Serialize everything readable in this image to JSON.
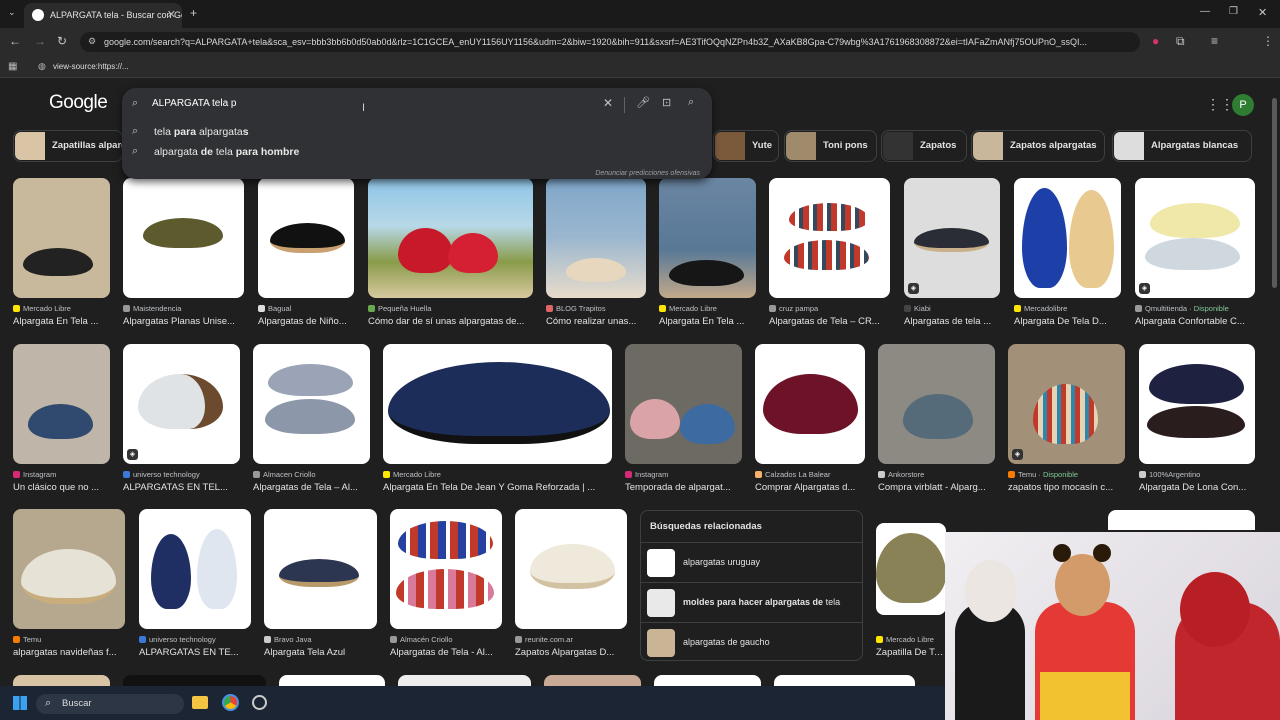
{
  "browser": {
    "tab_title": "ALPARGATA tela - Buscar con Google",
    "url": "google.com/search?q=ALPARGATA+tela&sca_esv=bbb3bb6b0d50ab0d&rlz=1C1GCEA_enUY1156UY1156&udm=2&biw=1920&bih=911&sxsrf=AE3TifOQqNZPn4b3Z_AXaKB8Gpa-C79wbg%3A1761968308872&ei=tIAFaZmANfj75OUPnO_ssQI...",
    "bookmark": "view-source:https://...",
    "profile_initial": "P"
  },
  "google": {
    "logo": "Google",
    "query": "ALPARGATA tela p",
    "suggestions": [
      {
        "pre": "tela ",
        "bold": "para ",
        "mid": "alpargata",
        "bold2": "s"
      },
      {
        "pre": "alpargata ",
        "bold": "de ",
        "mid": "tela ",
        "bold2": "para hombre"
      }
    ],
    "report": "Denunciar predicciones ofensivas",
    "avatar": "P"
  },
  "chips": [
    {
      "label": "Zapatillas alpargatas"
    },
    {
      "label": "Yute"
    },
    {
      "label": "Toni pons"
    },
    {
      "label": "Zapatos"
    },
    {
      "label": "Zapatos alpargatas"
    },
    {
      "label": "Alpargatas blancas"
    }
  ],
  "row1": [
    {
      "src": "Mercado Libre",
      "title": "Alpargata En Tela ...",
      "color": "#ffe600"
    },
    {
      "src": "Maistendencia",
      "title": "Alpargatas Planas Unise...",
      "color": "#999"
    },
    {
      "src": "Bagual",
      "title": "Alpargatas de Niño...",
      "color": "#ddd"
    },
    {
      "src": "Pequeña Huella",
      "title": "Cómo dar de sí unas alpargatas de...",
      "color": "#6aa84f"
    },
    {
      "src": "BLOG Trapitos",
      "title": "Cómo realizar unas...",
      "color": "#e06666"
    },
    {
      "src": "Mercado Libre",
      "title": "Alpargata En Tela ...",
      "color": "#ffe600"
    },
    {
      "src": "cruz pampa",
      "title": "Alpargatas de Tela – CR...",
      "color": "#999"
    },
    {
      "src": "Kiabi",
      "title": "Alpargatas de tela ...",
      "color": "#444"
    },
    {
      "src": "Mercadolibre",
      "title": "Alpargata De Tela D...",
      "color": "#ffe600"
    },
    {
      "src": "Qmultitienda",
      "disp": "Disponible",
      "title": "Alpargata Confortable C...",
      "color": "#999"
    }
  ],
  "row2": [
    {
      "src": "Instagram",
      "title": "Un clásico que no ...",
      "color": "#d62976"
    },
    {
      "src": "universo technology",
      "title": "ALPARGATAS EN TEL...",
      "color": "#3c78d8"
    },
    {
      "src": "Almacen Criollo",
      "title": "Alpargatas de Tela – Al...",
      "color": "#999"
    },
    {
      "src": "Mercado Libre",
      "title": "Alpargata En Tela De Jean Y Goma Reforzada | ...",
      "color": "#ffe600"
    },
    {
      "src": "Instagram",
      "title": "Temporada de alpargat...",
      "color": "#d62976"
    },
    {
      "src": "Calzados La Balear",
      "title": "Comprar Alpargatas d...",
      "color": "#f6b26b"
    },
    {
      "src": "Ankorstore",
      "title": "Compra virblatt - Alparg...",
      "color": "#ccc"
    },
    {
      "src": "Temu",
      "disp": "Disponible",
      "title": "zapatos tipo mocasín c...",
      "color": "#f57c00"
    },
    {
      "src": "100%Argentino",
      "title": "Alpargata De Lona Con...",
      "color": "#ccc"
    }
  ],
  "row3": [
    {
      "src": "Temu",
      "title": "alpargatas navideñas f...",
      "color": "#f57c00"
    },
    {
      "src": "universo technology",
      "title": "ALPARGATAS EN TE...",
      "color": "#3c78d8"
    },
    {
      "src": "Bravo Java",
      "title": "Alpargata Tela Azul",
      "color": "#ccc"
    },
    {
      "src": "Almacén Criollo",
      "title": "Alpargatas de Tela - Al...",
      "color": "#999"
    },
    {
      "src": "reunite.com.ar",
      "title": "Zapatos Alpargatas D...",
      "color": "#999"
    },
    {
      "src": "Mercado Libre",
      "title": "Zapatilla De Te...",
      "color": "#ffe600"
    }
  ],
  "related": {
    "title": "Búsquedas relacionadas",
    "items": [
      {
        "pre": "alpargatas uruguay",
        "bold": "",
        "post": ""
      },
      {
        "pre": "",
        "bold": "moldes para hacer alpargatas de ",
        "post": "tela"
      },
      {
        "pre": "alpargatas de gaucho",
        "bold": "",
        "post": ""
      }
    ]
  },
  "taskbar": {
    "search": "Buscar"
  }
}
